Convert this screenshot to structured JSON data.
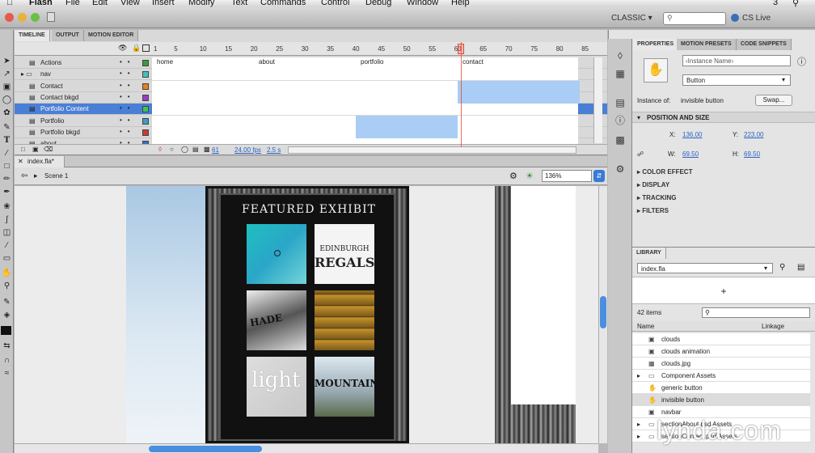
{
  "menubar": {
    "app": "Flash",
    "items": [
      "File",
      "Edit",
      "View",
      "Insert",
      "Modify",
      "Text",
      "Commands",
      "Control",
      "Debug",
      "Window",
      "Help"
    ],
    "right": "3"
  },
  "titlebar": {
    "workspace": "CLASSIC ▾",
    "cslive": "CS Live"
  },
  "timeline": {
    "tabs": [
      "TIMELINE",
      "OUTPUT",
      "MOTION EDITOR"
    ],
    "frame_numbers": [
      "1",
      "5",
      "10",
      "15",
      "20",
      "25",
      "30",
      "35",
      "40",
      "45",
      "50",
      "55",
      "60",
      "65",
      "70",
      "75",
      "80",
      "85"
    ],
    "layers": [
      {
        "name": "Actions",
        "color": "#3c9c3c",
        "labels": [
          {
            "text": "home",
            "f": 1
          },
          {
            "text": "about",
            "f": 21
          },
          {
            "text": "portfolio",
            "f": 41
          },
          {
            "text": "contact",
            "f": 61
          }
        ]
      },
      {
        "name": "nav",
        "color": "#3cc3c3",
        "labels": []
      },
      {
        "name": "Contact",
        "color": "#e8801c",
        "labels": []
      },
      {
        "name": "Contact bkgd",
        "color": "#9c3cc3",
        "labels": []
      },
      {
        "name": "Portfolio Content",
        "color": "#3cc360",
        "labels": [],
        "selected": true
      },
      {
        "name": "Portfolio",
        "color": "#3c9cc3",
        "labels": []
      },
      {
        "name": "Portfolio bkgd",
        "color": "#c33c3c",
        "labels": []
      },
      {
        "name": "about",
        "color": "#3c6cc3",
        "labels": []
      }
    ],
    "footer": {
      "frame": "61",
      "fps": "24.00 fps",
      "time": "2.5 s"
    }
  },
  "document": {
    "tab": "index.fla*",
    "scene": "Scene 1",
    "zoom": "136%"
  },
  "stage": {
    "featured": "FEATURED EXHIBIT",
    "thumb2_line1": "EDINBURGH",
    "thumb2_line2": "REGALS",
    "thumb3": "HADE",
    "thumb5": "light",
    "thumb6": "MOUNTAIN"
  },
  "properties": {
    "tabs": [
      "PROPERTIES",
      "MOTION PRESETS",
      "CODE SNIPPETS"
    ],
    "instance_name_placeholder": "‹Instance Name›",
    "type": "Button",
    "instance_of_label": "Instance of:",
    "instance_of": "invisible button",
    "swap": "Swap...",
    "pos_section": "POSITION AND SIZE",
    "x_label": "X:",
    "x": "136.00",
    "y_label": "Y:",
    "y": "223.00",
    "w_label": "W:",
    "w": "69.50",
    "h_label": "H:",
    "h": "69.50",
    "sections": [
      "COLOR EFFECT",
      "DISPLAY",
      "TRACKING",
      "FILTERS"
    ]
  },
  "library": {
    "title": "LIBRARY",
    "file": "index.fla",
    "count": "42 items",
    "col_name": "Name",
    "col_linkage": "Linkage",
    "items": [
      {
        "name": "clouds",
        "type": "symbol"
      },
      {
        "name": "clouds animation",
        "type": "symbol"
      },
      {
        "name": "clouds.jpg",
        "type": "bitmap"
      },
      {
        "name": "Component Assets",
        "type": "folder"
      },
      {
        "name": "generic button",
        "type": "button"
      },
      {
        "name": "invisible button",
        "type": "button"
      },
      {
        "name": "navbar",
        "type": "symbol"
      },
      {
        "name": "sectionAbout.psd Assets",
        "type": "folder"
      },
      {
        "name": "sectionContact.psd Assets",
        "type": "folder"
      }
    ]
  },
  "watermark": "lynda.com",
  "colors": {
    "selection": "#4a7fd6",
    "span": "#a9cdf4",
    "link": "#2a63c4"
  }
}
